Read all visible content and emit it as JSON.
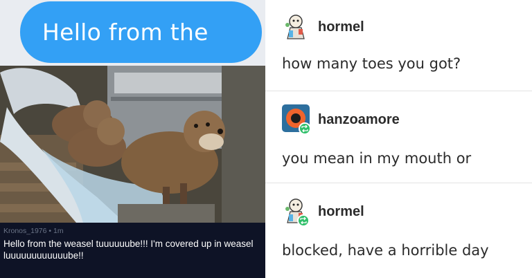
{
  "meme": {
    "bubble_text": "Hello from the",
    "caption_meta": "Kronos_1976 • 1m",
    "caption_text": "Hello from the weasel tuuuuuube!!! I'm covered up in weasel luuuuuuuuuuuube!!"
  },
  "posts": [
    {
      "username": "hormel",
      "avatar_icon": "cartoon-character-icon",
      "text": "how many toes you got?"
    },
    {
      "username": "hanzoamore",
      "avatar_icon": "orange-circle-icon",
      "reblog_icon": "reblog-icon",
      "text": "you mean in my mouth or"
    },
    {
      "username": "hormel",
      "avatar_icon": "cartoon-character-icon",
      "reblog_icon": "reblog-icon",
      "text": "blocked, have a horrible day"
    }
  ],
  "colors": {
    "bubble_blue": "#33a0f5",
    "reblog_green": "#2fbf6a",
    "caption_bg": "#0e1326"
  }
}
